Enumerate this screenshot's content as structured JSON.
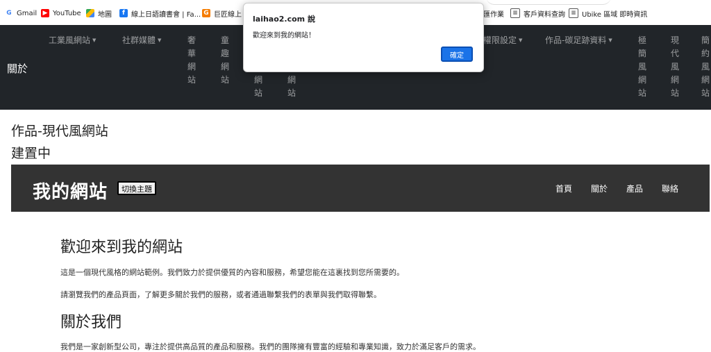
{
  "bookmarks": [
    {
      "icon": "google-icon",
      "label": "Gmail"
    },
    {
      "icon": "youtube-icon",
      "label": "YouTube"
    },
    {
      "icon": "maps-icon",
      "label": "地圖"
    },
    {
      "icon": "facebook-icon",
      "label": "線上日語讀書會 | Fa..."
    },
    {
      "icon": "bookmark-orange-icon",
      "label": "巨匠線上"
    },
    {
      "icon": "bookmark-doc-icon",
      "label": "匯作業"
    },
    {
      "icon": "bookmark-doc-icon",
      "label": "客戶資料查詢"
    },
    {
      "icon": "bookmark-doc-icon",
      "label": "Ubike 區域 即時資訊"
    }
  ],
  "navbar": {
    "brand": "關於",
    "dropdowns": [
      {
        "label": "工業風網站"
      },
      {
        "label": "社群媒體"
      },
      {
        "label": "權限設定"
      },
      {
        "label": "作品-碳足跡資料"
      }
    ],
    "vertical_items": [
      {
        "chars": [
          "奢",
          "華",
          "網",
          "站"
        ]
      },
      {
        "chars": [
          "童",
          "趣",
          "網",
          "站"
        ]
      },
      {
        "chars": [
          "網",
          "站"
        ]
      },
      {
        "chars": [
          "網",
          "站"
        ]
      },
      {
        "chars": [
          "極",
          "簡",
          "風",
          "網",
          "站"
        ]
      },
      {
        "chars": [
          "現",
          "代",
          "風",
          "網",
          "站"
        ]
      },
      {
        "chars": [
          "簡",
          "約",
          "風",
          "網",
          "站"
        ]
      }
    ]
  },
  "dialog": {
    "title": "laihao2.com 說",
    "message": "歡迎來到我的網站！",
    "ok_label": "確定"
  },
  "page": {
    "title": "作品-現代風網站",
    "subtitle": "建置中"
  },
  "site": {
    "logo": "我的網站",
    "theme_button": "切換主題",
    "nav": [
      "首頁",
      "關於",
      "產品",
      "聯絡"
    ]
  },
  "content": {
    "welcome_heading": "歡迎來到我的網站",
    "welcome_p1": "這是一個現代風格的網站範例。我們致力於提供優質的內容和服務，希望您能在這裏找到您所需要的。",
    "welcome_p2": "請瀏覽我們的產品頁面，了解更多關於我們的服務，或者通過聯繫我們的表單與我們取得聯繫。",
    "about_heading": "關於我們",
    "about_p1": "我們是一家創新型公司，專注於提供高品質的產品和服務。我們的團隊擁有豐富的經驗和專業知識，致力於滿足客戶的需求。"
  }
}
